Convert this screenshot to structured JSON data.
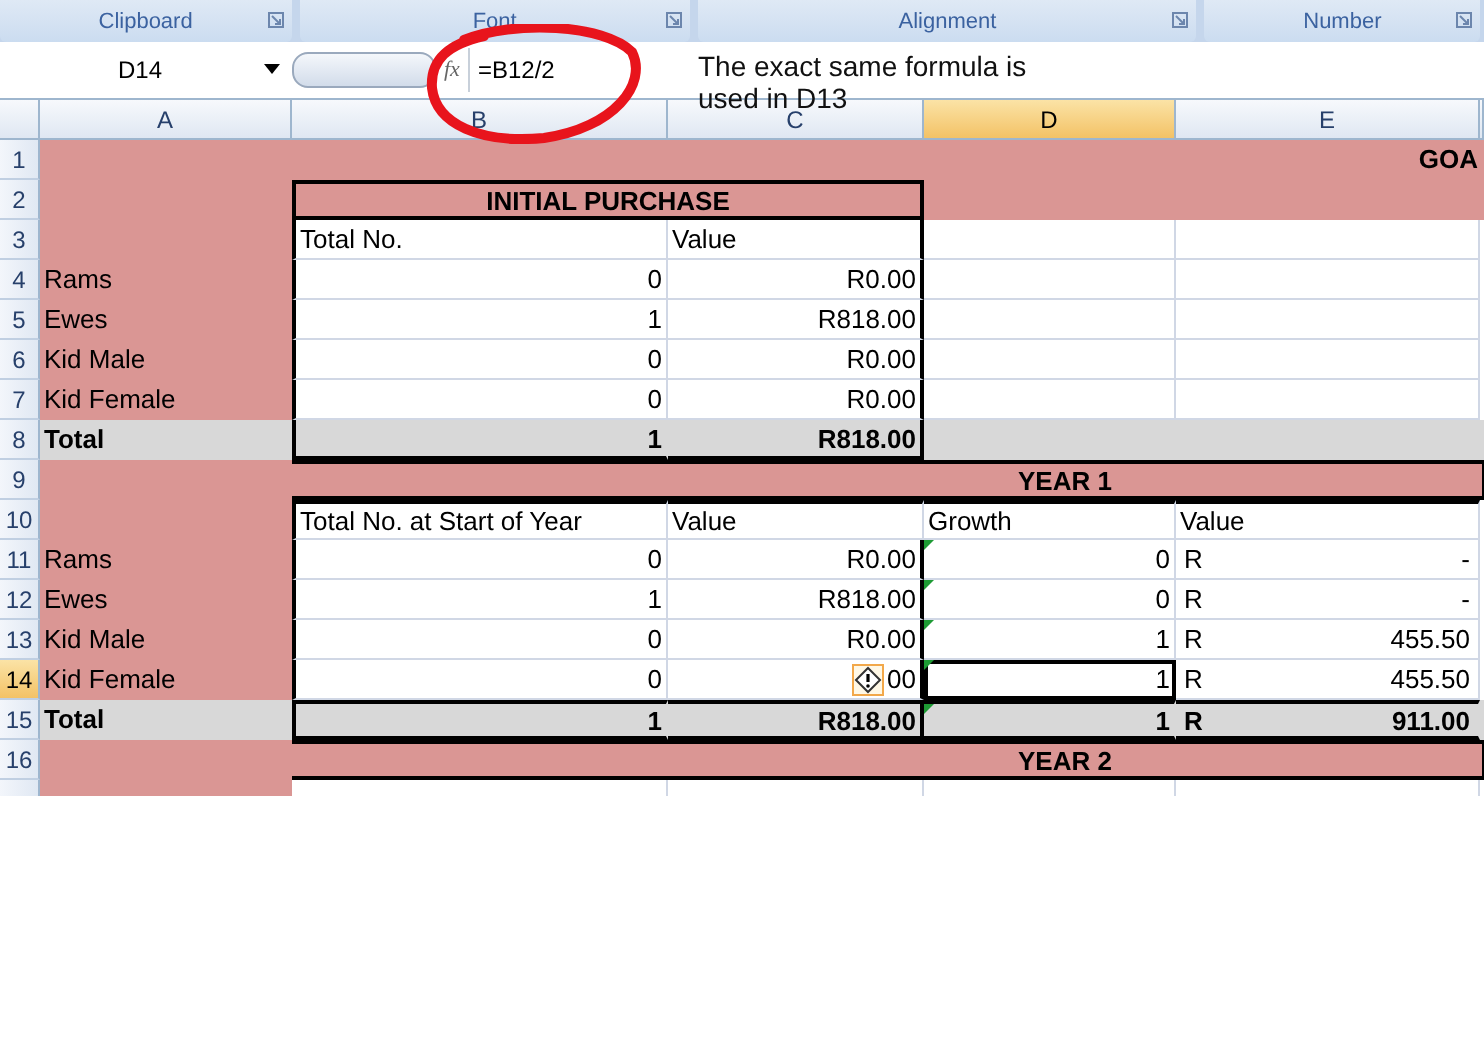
{
  "ribbon_groups": [
    "Clipboard",
    "Font",
    "Alignment",
    "Number"
  ],
  "formula_bar": {
    "name_box": "D14",
    "function_button": "fx",
    "formula": "=B12/2"
  },
  "annotation": {
    "text": "The exact same formula is used in D13"
  },
  "columns": [
    {
      "label": "A",
      "selected": false
    },
    {
      "label": "B",
      "selected": false
    },
    {
      "label": "C",
      "selected": false
    },
    {
      "label": "D",
      "selected": true
    },
    {
      "label": "E",
      "selected": false
    }
  ],
  "rows": [
    {
      "number": "1",
      "kind": "goal",
      "e": "GOA",
      "selected": false
    },
    {
      "number": "2",
      "kind": "table_title",
      "b": "INITIAL PURCHASE",
      "selected": false
    },
    {
      "number": "3",
      "kind": "header",
      "b": "Total No.",
      "c": "Value",
      "selected": false
    },
    {
      "number": "4",
      "kind": "item",
      "a": "Rams",
      "b": "0",
      "c": "R0.00",
      "selected": false
    },
    {
      "number": "5",
      "kind": "item",
      "a": "Ewes",
      "b": "1",
      "c": "R818.00",
      "selected": false
    },
    {
      "number": "6",
      "kind": "item",
      "a": "Kid Male",
      "b": "0",
      "c": "R0.00",
      "selected": false
    },
    {
      "number": "7",
      "kind": "item",
      "a": "Kid Female",
      "b": "0",
      "c": "R0.00",
      "selected": false
    },
    {
      "number": "8",
      "kind": "total",
      "a": "Total",
      "b": "1",
      "c": "R818.00",
      "selected": false
    },
    {
      "number": "9",
      "kind": "band",
      "title": "YEAR 1",
      "selected": false
    },
    {
      "number": "10",
      "kind": "header",
      "b": "Total No. at Start of Year",
      "c": "Value",
      "d": "Growth",
      "e": "Value",
      "selected": false
    },
    {
      "number": "11",
      "kind": "item",
      "a": "Rams",
      "b": "0",
      "c": "R0.00",
      "d": "0",
      "e": {
        "symbol": "R",
        "amount": "-"
      },
      "flagged": true,
      "selected": false
    },
    {
      "number": "12",
      "kind": "item",
      "a": "Ewes",
      "b": "1",
      "c": "R818.00",
      "d": "0",
      "e": {
        "symbol": "R",
        "amount": "-"
      },
      "flagged": true,
      "selected": false
    },
    {
      "number": "13",
      "kind": "item",
      "a": "Kid Male",
      "b": "0",
      "c": "R0.00",
      "d": "1",
      "e": {
        "symbol": "R",
        "amount": "455.50"
      },
      "flagged": true,
      "selected": false
    },
    {
      "number": "14",
      "kind": "item",
      "a": "Kid Female",
      "b": "0",
      "c": "00",
      "c_warning": true,
      "d": "1",
      "e": {
        "symbol": "R",
        "amount": "455.50"
      },
      "flagged": true,
      "selected": true
    },
    {
      "number": "15",
      "kind": "total",
      "a": "Total",
      "b": "1",
      "c": "R818.00",
      "d": "1",
      "e": {
        "symbol": "R",
        "amount": "911.00"
      },
      "flagged": true,
      "selected": false
    },
    {
      "number": "16",
      "kind": "band",
      "title": "YEAR 2",
      "selected": false
    },
    {
      "number": "",
      "kind": "partial",
      "selected": false
    }
  ]
}
